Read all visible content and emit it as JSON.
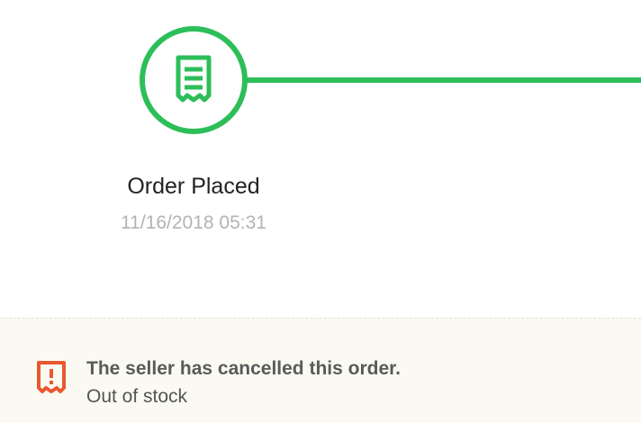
{
  "steps": [
    {
      "label": "Order Placed",
      "timestamp": "11/16/2018 05:31",
      "icon": "receipt-icon",
      "status": "completed"
    }
  ],
  "cancellation": {
    "title": "The seller has cancelled this order.",
    "reason": "Out of stock",
    "icon": "alert-receipt-icon"
  },
  "colors": {
    "progress_green": "#2dbe5a",
    "alert_orange": "#e9572f",
    "label_text": "#222222",
    "timestamp_text": "#b3b3b3",
    "notice_background": "#fbfaf2"
  }
}
